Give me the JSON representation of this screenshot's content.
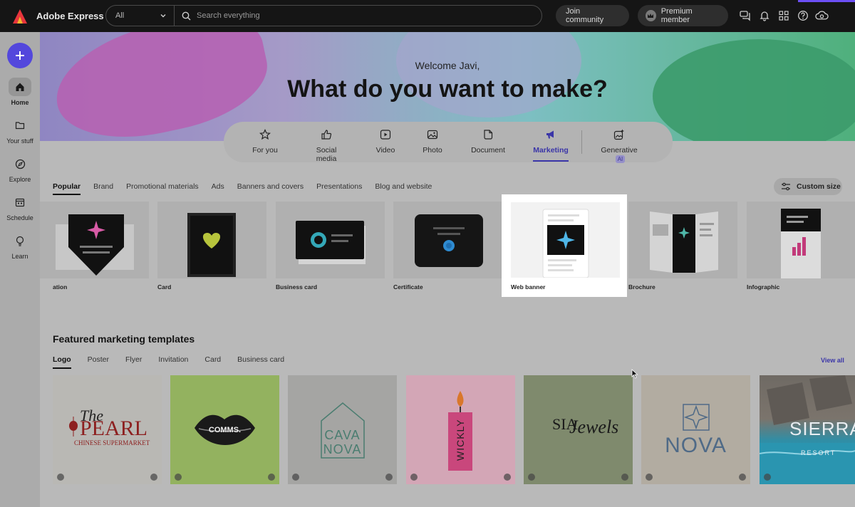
{
  "app": {
    "title": "Adobe Express"
  },
  "search": {
    "scope": "All",
    "placeholder": "Search everything"
  },
  "header": {
    "join_label": "Join community",
    "premium_label": "Premium member",
    "icons": [
      "chat-icon",
      "bell-icon",
      "apps-grid-icon",
      "help-icon",
      "creative-cloud-icon"
    ]
  },
  "sidebar": {
    "create_icon": "plus-icon",
    "items": [
      {
        "label": "Home",
        "icon": "home-icon",
        "active": true
      },
      {
        "label": "Your stuff",
        "icon": "folder-icon"
      },
      {
        "label": "Explore",
        "icon": "compass-icon"
      },
      {
        "label": "Schedule",
        "icon": "calendar-icon"
      },
      {
        "label": "Learn",
        "icon": "lightbulb-icon"
      }
    ]
  },
  "hero": {
    "welcome": "Welcome Javi,",
    "headline": "What do you want to make?"
  },
  "categories": [
    {
      "label": "For you",
      "icon": "star-icon"
    },
    {
      "label": "Social media",
      "icon": "thumbs-up-icon"
    },
    {
      "label": "Video",
      "icon": "video-icon"
    },
    {
      "label": "Photo",
      "icon": "image-icon"
    },
    {
      "label": "Document",
      "icon": "document-icon"
    },
    {
      "label": "Marketing",
      "icon": "megaphone-icon",
      "active": true
    },
    {
      "label": "Generative",
      "icon": "sparkle-image-icon",
      "badge": "AI"
    }
  ],
  "subtabs": [
    "Popular",
    "Brand",
    "Promotional materials",
    "Ads",
    "Banners and covers",
    "Presentations",
    "Blog and website"
  ],
  "custom_size_label": "Custom size",
  "templates": [
    "ation",
    "Card",
    "Business card",
    "Certificate",
    "Web banner",
    "Brochure",
    "Infographic"
  ],
  "featured": {
    "title": "Featured marketing templates",
    "tabs": [
      "Logo",
      "Poster",
      "Flyer",
      "Invitation",
      "Card",
      "Business card"
    ],
    "view_all": "View all",
    "cards": [
      {
        "line1": "The",
        "line2": "PEARL",
        "line3": "CHINESE SUPERMARKET"
      },
      {
        "line1": "COMMS."
      },
      {
        "line1": "CAVA",
        "line2": "NOVA"
      },
      {
        "line1": "WICKLY"
      },
      {
        "line1": "SIA",
        "line2": "Jewels"
      },
      {
        "line1": "NOVA"
      },
      {
        "line1": "SIERRA",
        "line2": "RESORT"
      }
    ]
  },
  "colors": {
    "accent": "#5347dc",
    "active_tab": "#3a35a8",
    "topbar": "#151515"
  }
}
